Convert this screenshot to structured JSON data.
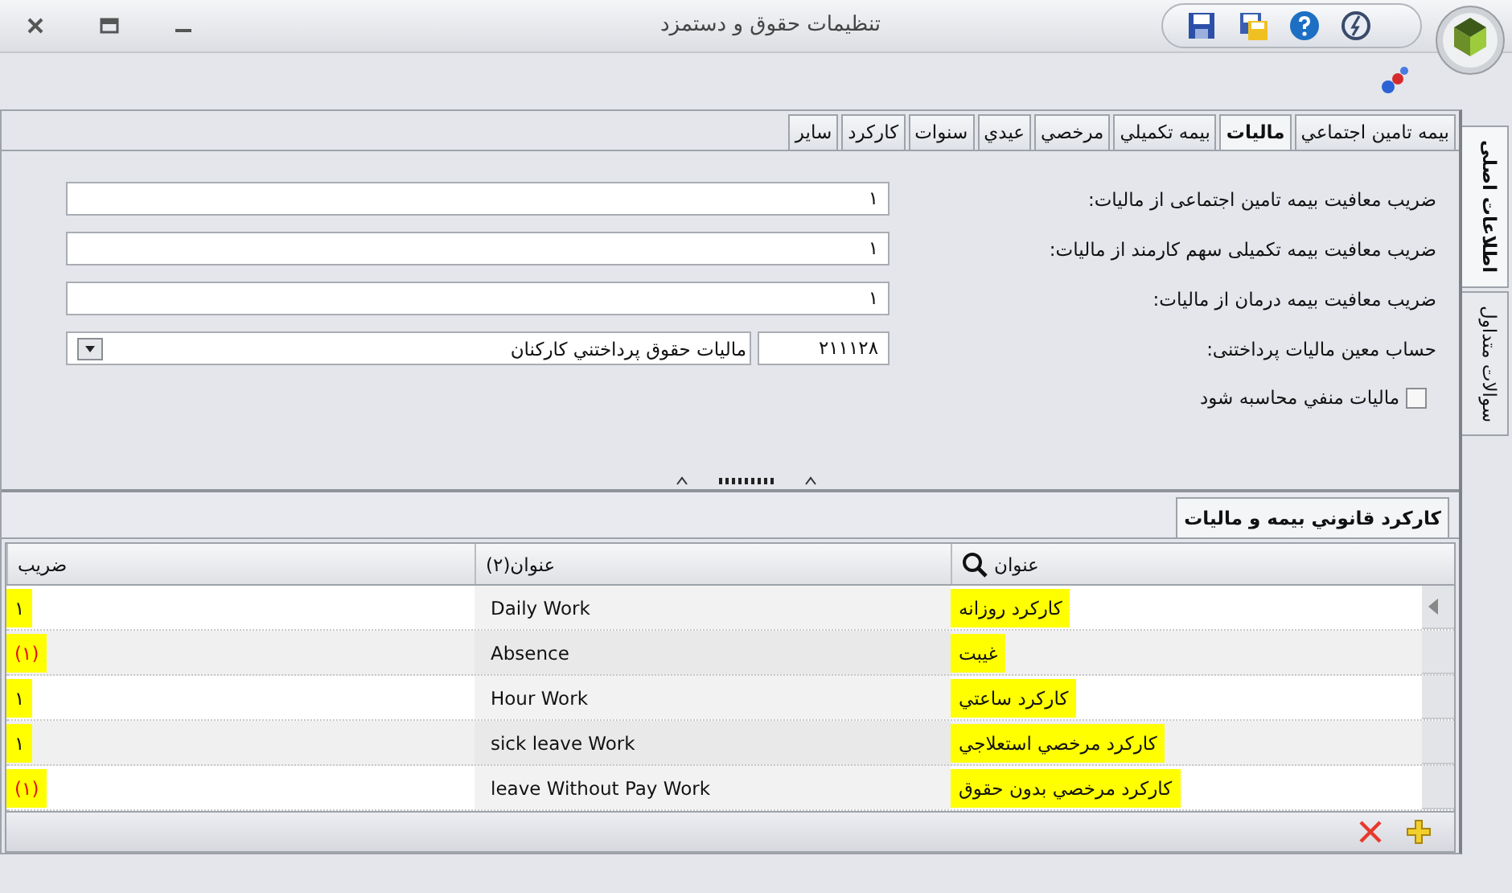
{
  "window": {
    "title": "تنظیمات حقوق و دستمزد"
  },
  "side_tabs": [
    {
      "label": "اطلاعات اصلی",
      "selected": true
    },
    {
      "label": "سوالات متداول",
      "selected": false
    }
  ],
  "tabs": [
    {
      "label": "بیمه تامین اجتماعي",
      "selected": false
    },
    {
      "label": "مالیات",
      "selected": true
    },
    {
      "label": "بیمه تکمیلي",
      "selected": false
    },
    {
      "label": "مرخصي",
      "selected": false
    },
    {
      "label": "عيدي",
      "selected": false
    },
    {
      "label": "سنوات",
      "selected": false
    },
    {
      "label": "کارکرد",
      "selected": false
    },
    {
      "label": "سایر",
      "selected": false
    }
  ],
  "form": {
    "fields": [
      {
        "kind": "text",
        "label": "ضریب معافیت بیمه تامین اجتماعی از مالیات:",
        "value": "۱"
      },
      {
        "kind": "text",
        "label": "ضریب معافیت بیمه تکمیلی سهم کارمند از مالیات:",
        "value": "۱"
      },
      {
        "kind": "text",
        "label": "ضریب معافیت بیمه درمان از مالیات:",
        "value": "۱"
      },
      {
        "kind": "account",
        "label": "حساب معین مالیات پرداختنی:",
        "code": "۲۱۱۱۲۸",
        "value": "مالیات حقوق پرداختني کارکنان"
      }
    ],
    "checkbox": {
      "label": "مالیات منفي محاسبه شود",
      "checked": false
    }
  },
  "grid": {
    "tab": "کارکرد قانوني بیمه و مالیات",
    "columns": [
      "عنوان",
      "عنوان(۲)",
      "ضریب"
    ],
    "rows": [
      {
        "title": "کارکرد روزانه",
        "title2": "Daily Work",
        "factor": "۱",
        "negative": false,
        "highlighted": true,
        "selected": true
      },
      {
        "title": "غيبت",
        "title2": "Absence",
        "factor": "(۱)",
        "negative": true,
        "highlighted": true,
        "selected": false
      },
      {
        "title": "کارکرد ساعتي",
        "title2": "Hour Work",
        "factor": "۱",
        "negative": false,
        "highlighted": true,
        "selected": false
      },
      {
        "title": "کارکرد مرخصي استعلاجي",
        "title2": "sick leave Work",
        "factor": "۱",
        "negative": false,
        "highlighted": true,
        "selected": false
      },
      {
        "title": "کارکرد مرخصي بدون حقوق",
        "title2": "leave Without Pay Work",
        "factor": "(۱)",
        "negative": true,
        "highlighted": true,
        "selected": false
      }
    ]
  }
}
